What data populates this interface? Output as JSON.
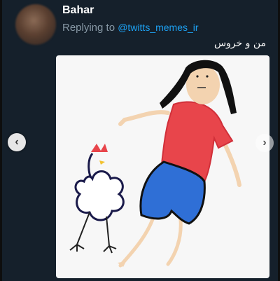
{
  "tweet": {
    "author_name": "Bahar",
    "replying_label": "Replying to",
    "replying_handle": "@twitts_memes_ir",
    "text": "من و خروس"
  },
  "media": {
    "icon": "drawing-image",
    "description_icon": "child-drawing-girl-and-rooster"
  },
  "carousel": {
    "prev_icon": "chevron-left-icon",
    "next_icon": "chevron-right-icon",
    "prev_glyph": "‹",
    "next_glyph": "›"
  },
  "colors": {
    "background": "#15202b",
    "link": "#1da1f2",
    "muted": "#8899a6"
  }
}
